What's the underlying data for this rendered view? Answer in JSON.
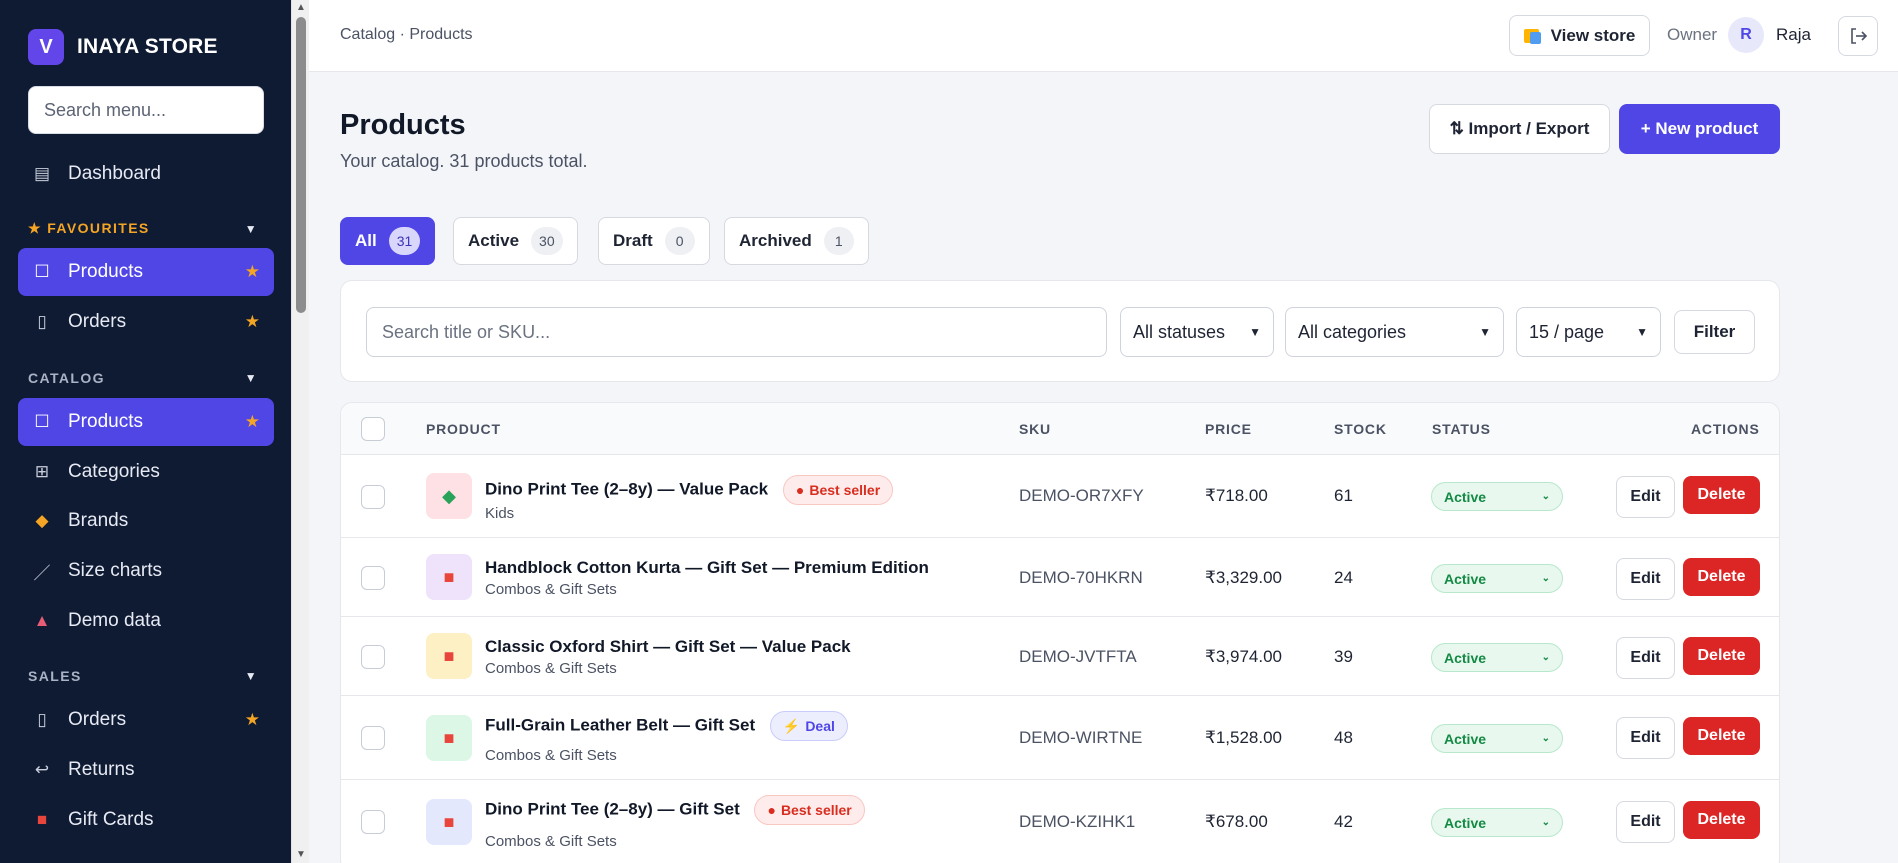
{
  "brand": {
    "logo_letter": "V",
    "name": "INAYA STORE",
    "logo_color": "#6246ea"
  },
  "sidebar": {
    "search_placeholder": "Search menu...",
    "dashboard": {
      "label": "Dashboard",
      "icon": "dashboard-icon"
    },
    "favourites": {
      "title": "FAVOURITES",
      "items": [
        {
          "label": "Products",
          "icon": "square-icon",
          "starred": true,
          "active": true
        },
        {
          "label": "Orders",
          "icon": "receipt-icon",
          "starred": true,
          "active": false
        }
      ]
    },
    "catalog": {
      "title": "CATALOG",
      "items": [
        {
          "label": "Products",
          "icon": "square-icon",
          "starred": true,
          "active": true
        },
        {
          "label": "Categories",
          "icon": "grid-icon"
        },
        {
          "label": "Brands",
          "icon": "tag-icon"
        },
        {
          "label": "Size charts",
          "icon": "ruler-icon"
        },
        {
          "label": "Demo data",
          "icon": "circus-tent-icon"
        }
      ]
    },
    "sales": {
      "title": "SALES",
      "items": [
        {
          "label": "Orders",
          "icon": "receipt-icon",
          "starred": true
        },
        {
          "label": "Returns",
          "icon": "return-arrow-icon"
        },
        {
          "label": "Gift Cards",
          "icon": "gift-icon"
        }
      ]
    }
  },
  "topbar": {
    "breadcrumb": "Catalog · Products",
    "view_store_label": "View store",
    "owner_label": "Owner",
    "avatar_initial": "R",
    "user_name": "Raja"
  },
  "page": {
    "title": "Products",
    "subtitle": "Your catalog. 31 products total.",
    "import_export_label": "⇅ Import / Export",
    "new_product_label": "+ New product"
  },
  "tabs": [
    {
      "label": "All",
      "count": "31",
      "active": true
    },
    {
      "label": "Active",
      "count": "30"
    },
    {
      "label": "Draft",
      "count": "0"
    },
    {
      "label": "Archived",
      "count": "1"
    }
  ],
  "filters": {
    "search_placeholder": "Search title or SKU...",
    "status_value": "All statuses",
    "category_value": "All categories",
    "per_page_value": "15 / page",
    "filter_label": "Filter"
  },
  "table": {
    "headers": {
      "product": "PRODUCT",
      "sku": "SKU",
      "price": "PRICE",
      "stock": "STOCK",
      "status": "STATUS",
      "actions": "ACTIONS"
    },
    "edit_label": "Edit",
    "delete_label": "Delete",
    "rows": [
      {
        "name": "Dino Print Tee (2–8y) — Value Pack",
        "badge": "Best seller",
        "badge_type": "best",
        "badge_icon": "fire-icon",
        "category": "Kids",
        "sku": "DEMO-OR7XFY",
        "price": "₹718.00",
        "stock": "61",
        "status": "Active",
        "thumb_icon": "dinosaur-icon",
        "thumb_color": "#fde1e4"
      },
      {
        "name": "Handblock Cotton Kurta — Gift Set — Premium Edition",
        "badge": "",
        "category": "Combos & Gift Sets",
        "sku": "DEMO-70HKRN",
        "price": "₹3,329.00",
        "stock": "24",
        "status": "Active",
        "thumb_icon": "gift-icon",
        "thumb_color": "#efe3fb"
      },
      {
        "name": "Classic Oxford Shirt — Gift Set — Value Pack",
        "badge": "",
        "category": "Combos & Gift Sets",
        "sku": "DEMO-JVTFTA",
        "price": "₹3,974.00",
        "stock": "39",
        "status": "Active",
        "thumb_icon": "gift-icon",
        "thumb_color": "#fdf0c4"
      },
      {
        "name": "Full-Grain Leather Belt — Gift Set",
        "badge": "Deal",
        "badge_type": "deal",
        "badge_icon": "bolt-icon",
        "category": "Combos & Gift Sets",
        "sku": "DEMO-WIRTNE",
        "price": "₹1,528.00",
        "stock": "48",
        "status": "Active",
        "thumb_icon": "gift-icon",
        "thumb_color": "#dcf7e6"
      },
      {
        "name": "Dino Print Tee (2–8y) — Gift Set",
        "badge": "Best seller",
        "badge_type": "best",
        "badge_icon": "fire-icon",
        "category": "Combos & Gift Sets",
        "sku": "DEMO-KZIHK1",
        "price": "₹678.00",
        "stock": "42",
        "status": "Active",
        "thumb_icon": "gift-icon",
        "thumb_color": "#e4e8fc"
      }
    ]
  },
  "colors": {
    "accent": "#4f46e5",
    "sidebar_bg": "#0f1a33",
    "danger": "#dc2626",
    "success": "#138a43",
    "star": "#f5a524"
  }
}
